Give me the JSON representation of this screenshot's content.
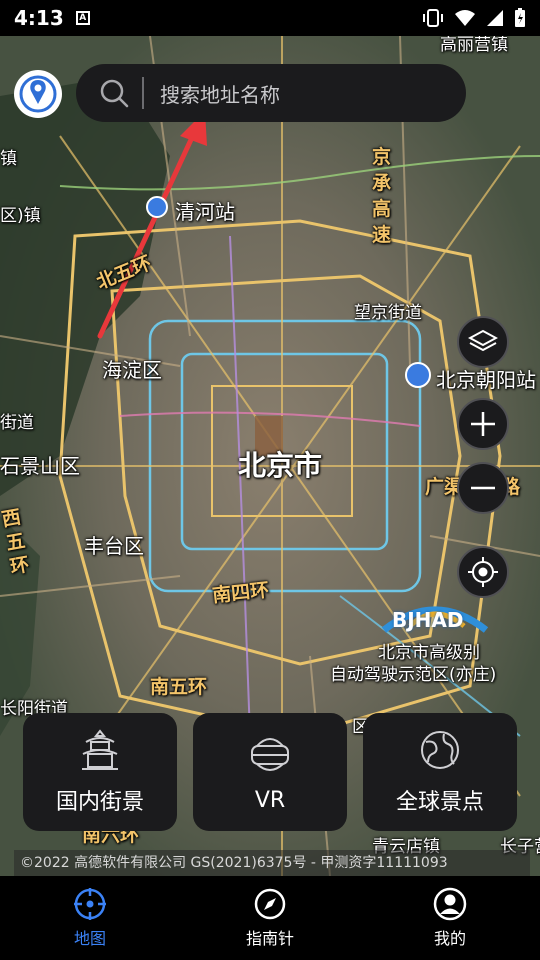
{
  "status_bar": {
    "time": "4:13",
    "notification_badge": "A"
  },
  "search": {
    "placeholder": "搜索地址名称"
  },
  "map": {
    "labels": {
      "top_right_place": "高丽营镇",
      "qinghe_station": "清河站",
      "jingcheng_expressway": "京承高速",
      "north_fifth_ring": "北五环",
      "wangjing_street": "望京街道",
      "haidian": "海淀区",
      "beijing_chaoyang_station": "北京朝阳站",
      "street_left": "街道",
      "shijingshan": "石景山区",
      "beijing_city": "北京市",
      "jingjin_expressway": "广渠快速路",
      "west_fifth_ring": "西五环",
      "fengtai": "丰台区",
      "south_fourth_ring": "南四环",
      "bjhad_logo": "BJHAD",
      "bjhad_line1": "北京市高级别",
      "bjhad_line2": "自动驾驶示范区(亦庄)",
      "south_fifth_ring": "南五环",
      "changyang_street": "长阳街道",
      "left_town": "镇",
      "left_edge_town": "区)镇",
      "south_sixth_ring": "南六环",
      "qingyundian": "青云店镇",
      "changziying": "长子营",
      "kaoqu": "区"
    }
  },
  "cards": [
    {
      "label": "国内街景",
      "icon": "pagoda-icon"
    },
    {
      "label": "VR",
      "icon": "vr-headset-icon"
    },
    {
      "label": "全球景点",
      "icon": "globe-icon"
    }
  ],
  "copyright": "©2022 高德软件有限公司 GS(2021)6375号 - 甲测资字11111093",
  "nav": [
    {
      "label": "地图",
      "icon": "map-crosshair-icon",
      "active": true
    },
    {
      "label": "指南针",
      "icon": "compass-icon",
      "active": false
    },
    {
      "label": "我的",
      "icon": "profile-icon",
      "active": false
    }
  ],
  "colors": {
    "accent": "#3b82f6",
    "road_label": "#f3c46a",
    "arrow": "#e8383b",
    "control_bg": "#1b1b1d"
  }
}
